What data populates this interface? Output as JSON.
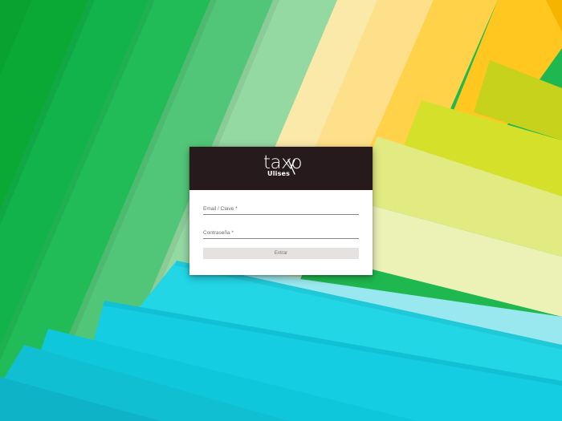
{
  "brand": {
    "name": "taxo",
    "subtitle": "Ulises"
  },
  "login": {
    "email_label": "Email / Clave *",
    "password_label": "Contraseña *",
    "submit_label": "Entrar"
  },
  "colors": {
    "header": "#261a1c",
    "card": "#ffffff",
    "button": "#e5e2e0"
  },
  "icons": {
    "logo_mark": "taxo-x-logo-icon"
  }
}
